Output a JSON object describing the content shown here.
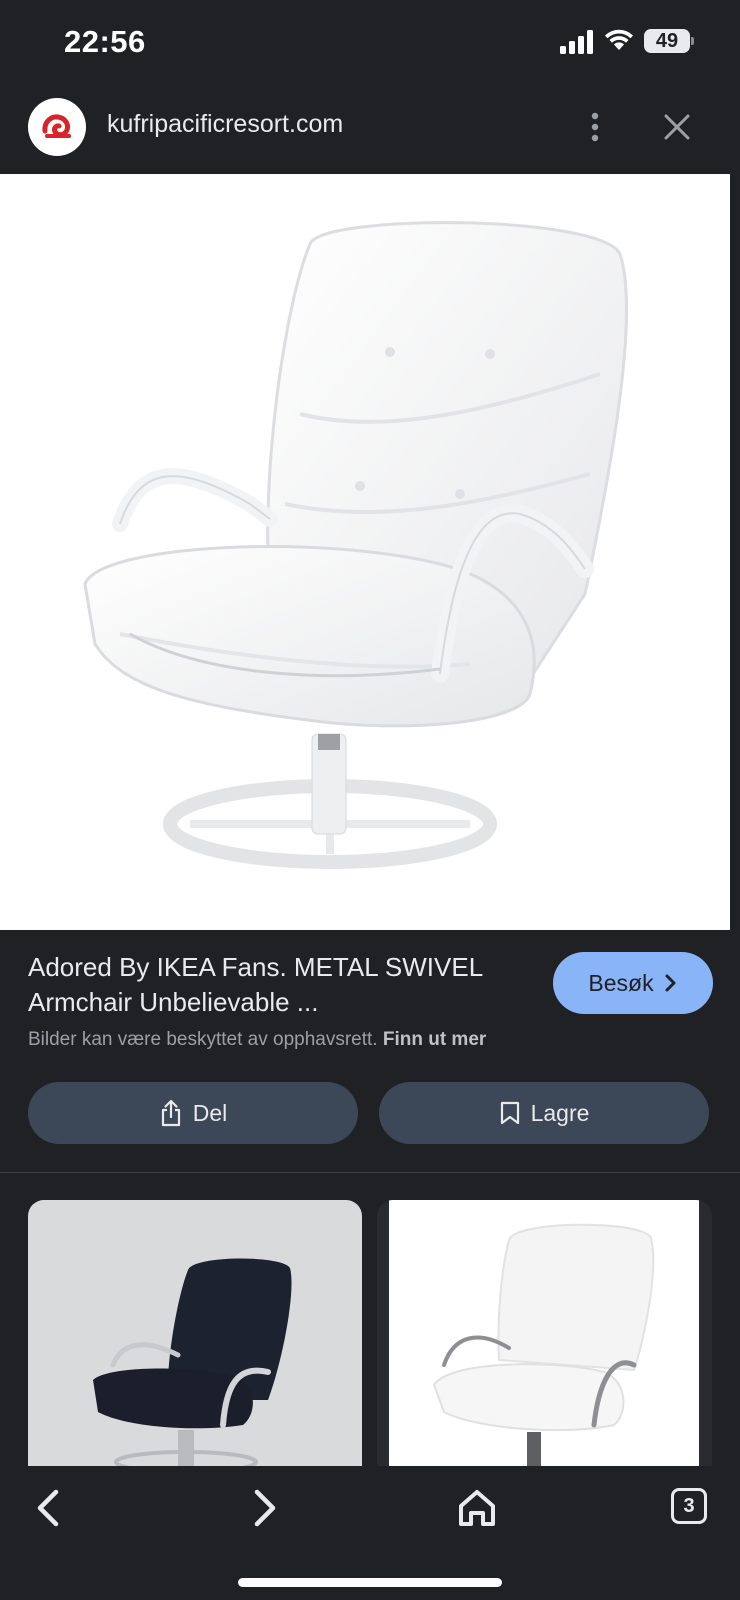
{
  "status_bar": {
    "time": "22:56",
    "battery_level": "49"
  },
  "browser": {
    "url": "kufripacificresort.com",
    "menu_icon": "more-vertical-icon",
    "close_icon": "close-icon"
  },
  "result": {
    "title": "Adored By IKEA Fans. METAL SWIVEL Armchair Unbelievable ...",
    "visit_label": "Besøk",
    "copyright_text": "Bilder kan være beskyttet av opphavsrett.",
    "learn_more": "Finn ut mer",
    "share_label": "Del",
    "save_label": "Lagre"
  },
  "toolbar": {
    "tab_count": "3",
    "icons": [
      "back-icon",
      "forward-icon",
      "home-icon",
      "tabs-icon"
    ]
  },
  "colors": {
    "background": "#202124",
    "accent_button": "#8ab4f8",
    "secondary_button": "#3c4758"
  }
}
